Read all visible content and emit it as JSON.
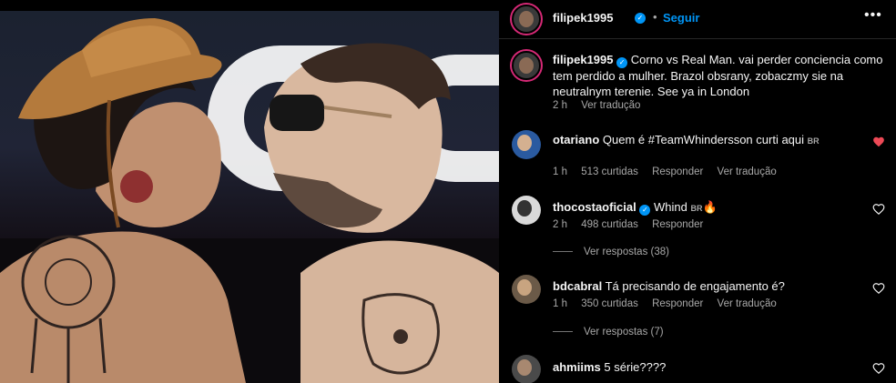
{
  "post": {
    "username": "filipek1995",
    "follow_label": "Seguir",
    "caption": "Corno vs Real Man. vai perder conciencia como tem perdido a mulher. Brazol obsrany, zobaczmy sie na neutralnym terenie. See ya in London",
    "time": "2 h",
    "translate": "Ver tradução"
  },
  "comments": [
    {
      "username": "otariano",
      "text": "Quem é #TeamWhindersson curti aqui",
      "flag": "BR",
      "time": "1 h",
      "likes": "513 curtidas",
      "reply": "Responder",
      "translate": "Ver tradução",
      "liked": true
    },
    {
      "username": "thocostaoficial",
      "text": "Whind",
      "flag": "BR",
      "emoji": "🔥",
      "time": "2 h",
      "likes": "498 curtidas",
      "reply": "Responder",
      "view_replies": "Ver respostas (38)"
    },
    {
      "username": "bdcabral",
      "text": "Tá precisando de engajamento é?",
      "time": "1 h",
      "likes": "350 curtidas",
      "reply": "Responder",
      "translate": "Ver tradução",
      "view_replies": "Ver respostas (7)"
    },
    {
      "username": "ahmiims",
      "text": "5 série????"
    }
  ],
  "colors": {
    "accent": "#0095f6",
    "like": "#ed4956",
    "muted": "#a8a8a8"
  }
}
